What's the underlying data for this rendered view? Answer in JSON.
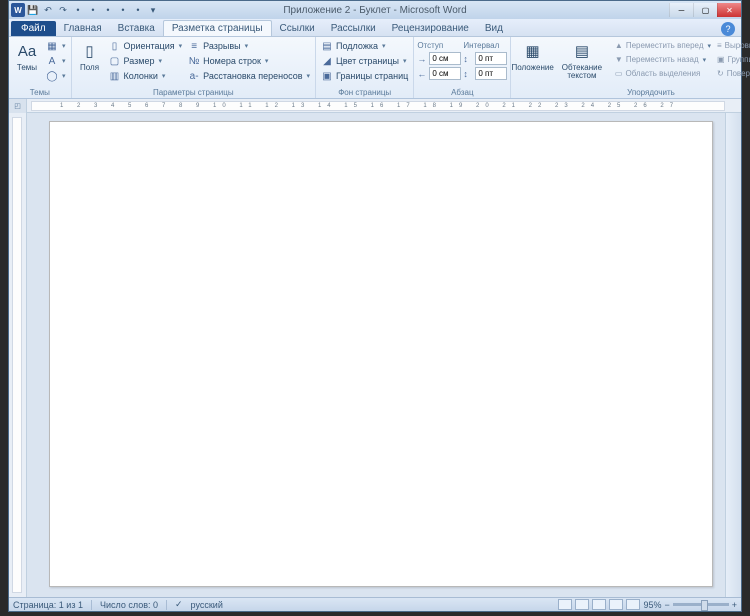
{
  "title": "Приложение 2 - Буклет - Microsoft Word",
  "tabs": {
    "file": "Файл",
    "items": [
      "Главная",
      "Вставка",
      "Разметка страницы",
      "Ссылки",
      "Рассылки",
      "Рецензирование",
      "Вид"
    ],
    "active_index": 2
  },
  "ribbon": {
    "themes": {
      "label": "Темы",
      "btn": "Темы"
    },
    "page_setup": {
      "label": "Параметры страницы",
      "margins": "Поля",
      "orientation": "Ориентация",
      "size": "Размер",
      "columns": "Колонки",
      "breaks": "Разрывы",
      "line_numbers": "Номера строк",
      "hyphenation": "Расстановка переносов"
    },
    "page_bg": {
      "label": "Фон страницы",
      "watermark": "Подложка",
      "page_color": "Цвет страницы",
      "borders": "Границы страниц"
    },
    "paragraph": {
      "label": "Абзац",
      "indent_label": "Отступ",
      "spacing_label": "Интервал",
      "indent_left": "0 см",
      "indent_right": "0 см",
      "space_before": "0 пт",
      "space_after": "0 пт"
    },
    "arrange": {
      "label": "Упорядочить",
      "position": "Положение",
      "wrap": "Обтекание текстом",
      "forward": "Переместить вперед",
      "backward": "Переместить назад",
      "selection": "Область выделения",
      "align": "Выровнять",
      "group": "Группировать",
      "rotate": "Повернуть"
    }
  },
  "status": {
    "page": "Страница: 1 из 1",
    "words": "Число слов: 0",
    "lang": "русский",
    "zoom": "95%"
  }
}
